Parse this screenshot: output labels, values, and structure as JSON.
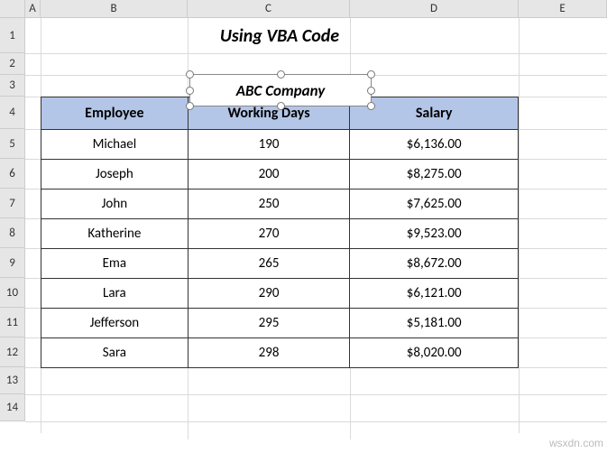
{
  "columns": [
    "A",
    "B",
    "C",
    "D",
    "E"
  ],
  "rows": [
    "1",
    "2",
    "3",
    "4",
    "5",
    "6",
    "7",
    "8",
    "9",
    "10",
    "11",
    "12",
    "13",
    "14"
  ],
  "title": "Using VBA Code",
  "textbox": {
    "value": "ABC Company"
  },
  "table": {
    "headers": {
      "employee": "Employee",
      "working_days": "Working Days",
      "salary": "Salary"
    },
    "data": [
      {
        "employee": "Michael",
        "working_days": "190",
        "salary": "$6,136.00"
      },
      {
        "employee": "Joseph",
        "working_days": "200",
        "salary": "$8,275.00"
      },
      {
        "employee": "John",
        "working_days": "250",
        "salary": "$7,625.00"
      },
      {
        "employee": "Katherine",
        "working_days": "270",
        "salary": "$9,523.00"
      },
      {
        "employee": "Ema",
        "working_days": "265",
        "salary": "$8,672.00"
      },
      {
        "employee": "Lara",
        "working_days": "290",
        "salary": "$6,121.00"
      },
      {
        "employee": "Jefferson",
        "working_days": "295",
        "salary": "$5,181.00"
      },
      {
        "employee": "Sara",
        "working_days": "298",
        "salary": "$8,020.00"
      }
    ]
  },
  "watermark": "wsxdn.com"
}
